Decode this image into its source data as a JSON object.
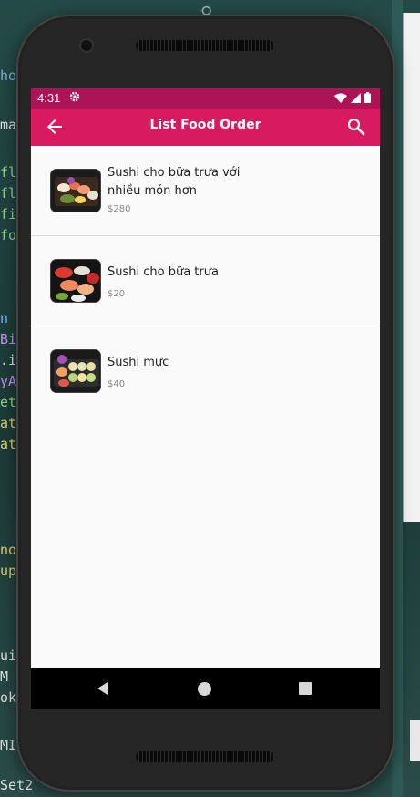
{
  "status_bar": {
    "time": "4:31"
  },
  "app_bar": {
    "title": "List Food Order"
  },
  "orders": [
    {
      "name": "Sushi cho bữa trưa với nhiều món hơn",
      "price": "$280"
    },
    {
      "name": "Sushi cho bữa trưa",
      "price": "$20"
    },
    {
      "name": "Sushi mực",
      "price": "$40"
    }
  ],
  "icons": {
    "back": "arrow-back-icon",
    "search": "search-icon",
    "settings": "gear-icon",
    "wifi": "wifi-icon",
    "signal": "signal-icon",
    "battery": "battery-icon",
    "nav_back": "triangle-back-icon",
    "nav_home": "circle-home-icon",
    "nav_recent": "square-recent-icon"
  },
  "colors": {
    "status_bar": "#ad1457",
    "app_bar": "#d81b60",
    "screen_background": "#fafafa",
    "price_text": "#8a8a8a",
    "nav_bar": "#000000"
  }
}
